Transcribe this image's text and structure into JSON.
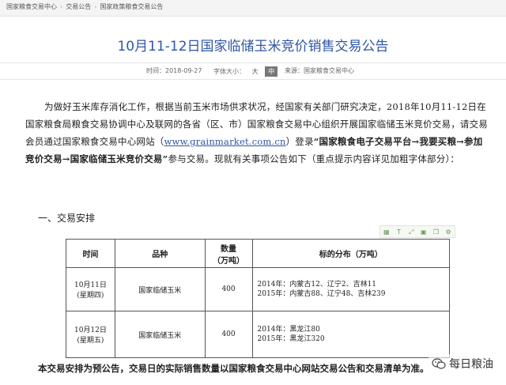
{
  "breadcrumb": [
    "国家粮食交易中心",
    "交易公告",
    "国家政策粮食交易公告"
  ],
  "article": {
    "title": "10月11-12日国家临储玉米竞价销售交易公告",
    "time_label": "时间：2018-09-27",
    "fontsize_label": "字体大小：",
    "fontsize_options": [
      "大",
      "中"
    ],
    "source_label": "来源：国家粮食交易中心"
  },
  "intro": {
    "p1": "为做好玉米库存消化工作，根据当前玉米市场供求状况，经国家有关部门研究决定，2018年10月11-12日在国家粮食局粮食交易协调中心及联网的各省（区、市）国家粮食交易中心组织开展国家临储玉米竞价交易，请交易会员通过国家粮食交易中心网站（",
    "link": "www.grainmarket.com.cn",
    "p2": "）登录",
    "bold": "“国家粮食电子交易平台→我要买粮→参加竞价交易→国家临储玉米竞价交易”",
    "p3": "参与交易。现就有关事项公告如下（重点提示内容详见加粗字体部分）："
  },
  "section1": "一、交易安排",
  "toolbar_icons": [
    "table-icon",
    "text-icon",
    "expand-icon",
    "image-icon",
    "copy-icon",
    "settings-icon"
  ],
  "table": {
    "headers": [
      "时间",
      "品种",
      "数量\n（万吨）",
      "标的分布（万吨）"
    ],
    "rows": [
      {
        "time": [
          "10月11日",
          "(星期四)"
        ],
        "variety": "国家临储玉米",
        "qty": "400",
        "dist": [
          "2014年：内蒙古12、辽宁2、吉林11",
          "2015年：内蒙古88、辽宁48、吉林239"
        ]
      },
      {
        "time": [
          "10月12日",
          "(星期五)"
        ],
        "variety": "国家临储玉米",
        "qty": "400",
        "dist": [
          "2014年：黑龙江80",
          "2015年：黑龙江320"
        ]
      }
    ]
  },
  "footer_text": "本交易安排为预公告，交易日的实际销售数量以国家粮食交易中心网站交易公告和交易清单为准。",
  "watermark": "每日粮油"
}
